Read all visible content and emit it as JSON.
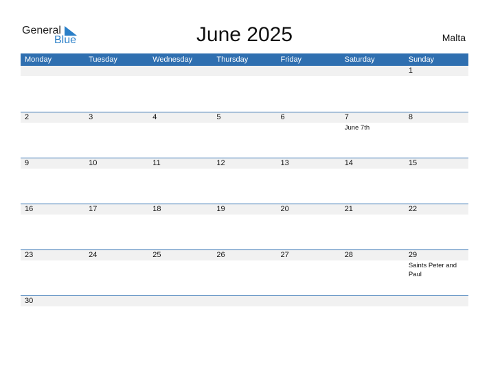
{
  "logo": {
    "general": "General",
    "blue": "Blue"
  },
  "title": "June 2025",
  "country": "Malta",
  "weekdays": [
    "Monday",
    "Tuesday",
    "Wednesday",
    "Thursday",
    "Friday",
    "Saturday",
    "Sunday"
  ],
  "weeks": [
    [
      {
        "d": ""
      },
      {
        "d": ""
      },
      {
        "d": ""
      },
      {
        "d": ""
      },
      {
        "d": ""
      },
      {
        "d": ""
      },
      {
        "d": "1"
      }
    ],
    [
      {
        "d": "2"
      },
      {
        "d": "3"
      },
      {
        "d": "4"
      },
      {
        "d": "5"
      },
      {
        "d": "6"
      },
      {
        "d": "7",
        "ev": "June 7th"
      },
      {
        "d": "8"
      }
    ],
    [
      {
        "d": "9"
      },
      {
        "d": "10"
      },
      {
        "d": "11"
      },
      {
        "d": "12"
      },
      {
        "d": "13"
      },
      {
        "d": "14"
      },
      {
        "d": "15"
      }
    ],
    [
      {
        "d": "16"
      },
      {
        "d": "17"
      },
      {
        "d": "18"
      },
      {
        "d": "19"
      },
      {
        "d": "20"
      },
      {
        "d": "21"
      },
      {
        "d": "22"
      }
    ],
    [
      {
        "d": "23"
      },
      {
        "d": "24"
      },
      {
        "d": "25"
      },
      {
        "d": "26"
      },
      {
        "d": "27"
      },
      {
        "d": "28"
      },
      {
        "d": "29",
        "ev": "Saints Peter and Paul"
      }
    ],
    [
      {
        "d": "30"
      },
      {
        "d": ""
      },
      {
        "d": ""
      },
      {
        "d": ""
      },
      {
        "d": ""
      },
      {
        "d": ""
      },
      {
        "d": ""
      }
    ]
  ]
}
